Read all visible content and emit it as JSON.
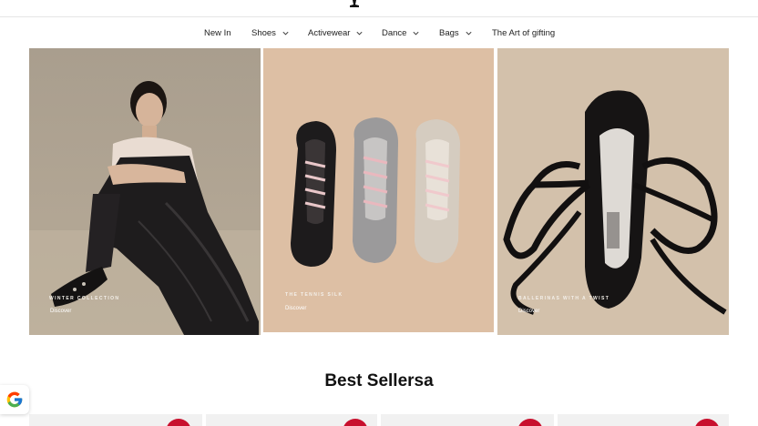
{
  "nav": {
    "items": [
      {
        "label": "New In",
        "has_dropdown": false
      },
      {
        "label": "Shoes",
        "has_dropdown": true
      },
      {
        "label": "Activewear",
        "has_dropdown": true
      },
      {
        "label": "Dance",
        "has_dropdown": true
      },
      {
        "label": "Bags",
        "has_dropdown": true
      },
      {
        "label": "The Art of gifting",
        "has_dropdown": false
      }
    ]
  },
  "tiles": [
    {
      "caption": "WINTER COLLECTION",
      "link": "Discover"
    },
    {
      "caption": "THE TENNIS SILK",
      "link": "Discover"
    },
    {
      "caption": "BALLERINAS WITH A TWIST",
      "link": "Discover"
    }
  ],
  "best_sellers": {
    "title": "Best Sellersa"
  },
  "colors": {
    "accent_sale": "#c8102e",
    "text": "#1a1a1a"
  },
  "icons": {
    "logo": "brand-logo",
    "chevron": "chevron-down-icon",
    "google": "google-icon"
  }
}
